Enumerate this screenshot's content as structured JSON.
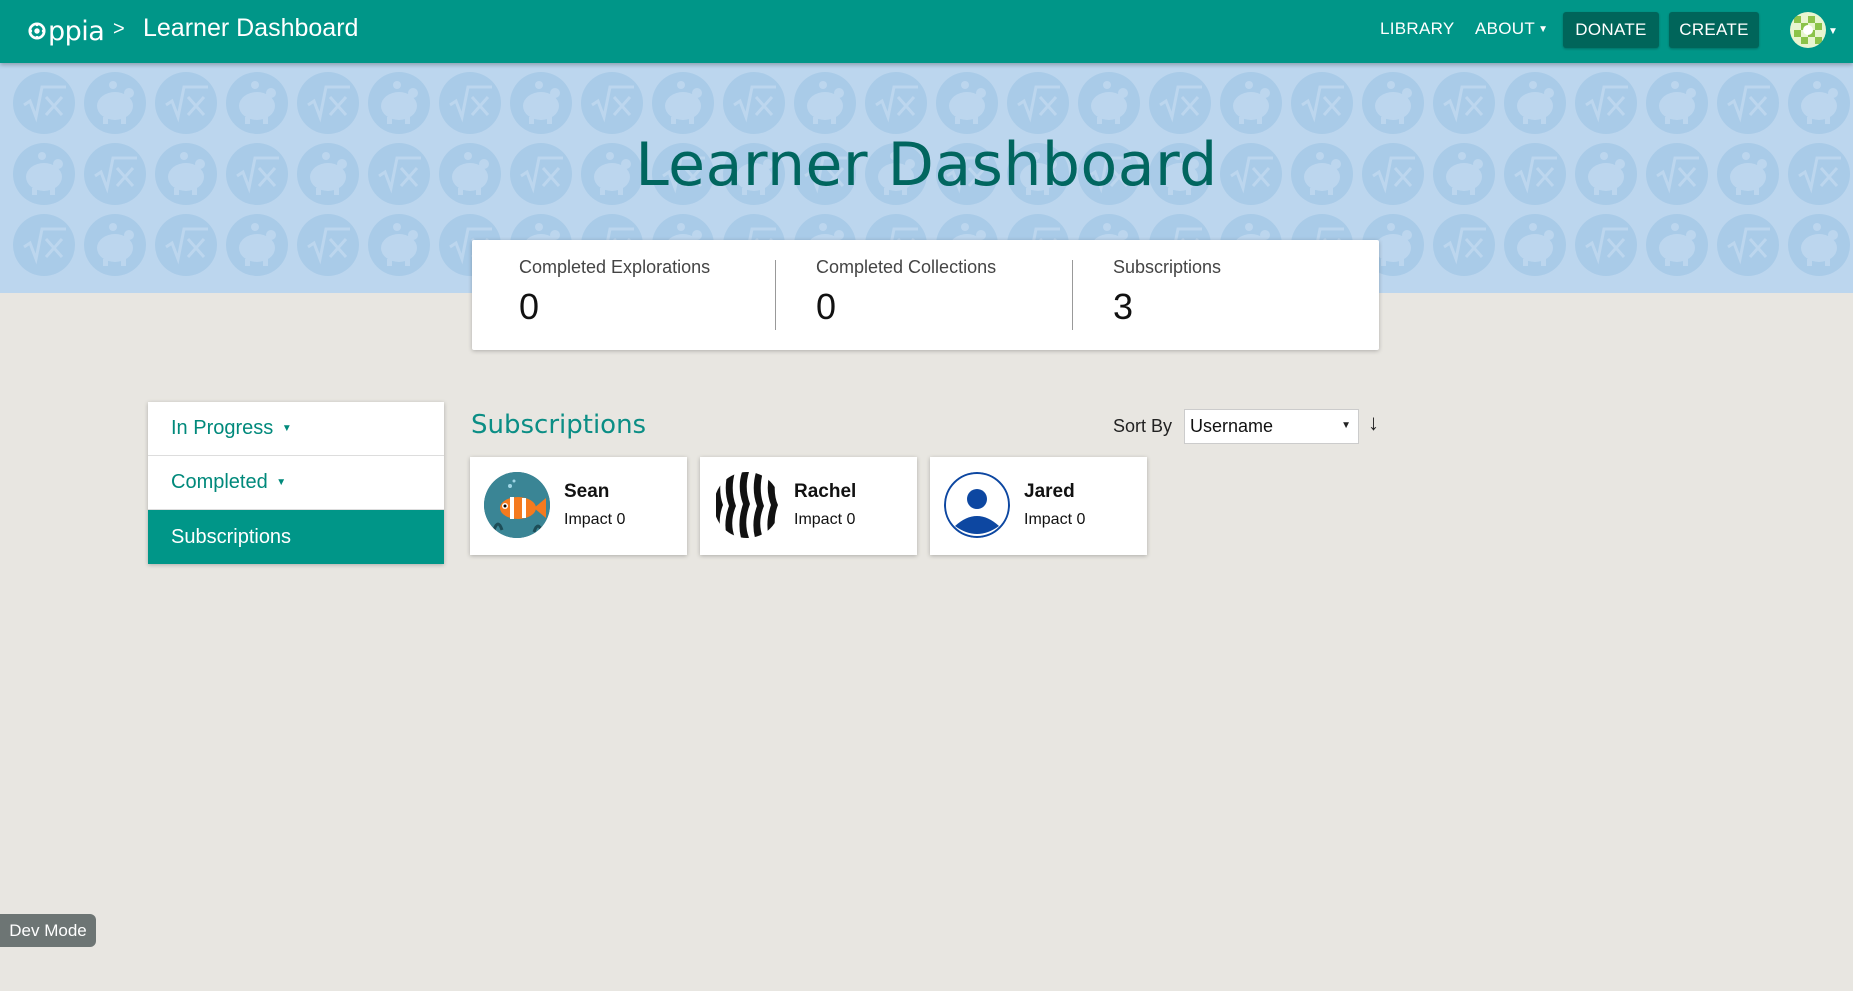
{
  "header": {
    "logo_text": "ppia",
    "breadcrumb_separator": ">",
    "page_name": "Learner Dashboard",
    "nav": {
      "library": "LIBRARY",
      "about": "ABOUT",
      "donate": "DONATE",
      "create": "CREATE"
    },
    "colors": {
      "bar": "#009688",
      "button": "#00655a"
    }
  },
  "banner": {
    "title": "Learner Dashboard",
    "pattern_icons": [
      "sqrt-x-icon",
      "piggy-bank-icon"
    ],
    "background": "#bcd6ee"
  },
  "stats": [
    {
      "label": "Completed Explorations",
      "value": "0"
    },
    {
      "label": "Completed Collections",
      "value": "0"
    },
    {
      "label": "Subscriptions",
      "value": "3"
    }
  ],
  "sidenav": [
    {
      "label": "In Progress",
      "has_dropdown": true,
      "active": false
    },
    {
      "label": "Completed",
      "has_dropdown": true,
      "active": false
    },
    {
      "label": "Subscriptions",
      "has_dropdown": false,
      "active": true
    }
  ],
  "section": {
    "title": "Subscriptions",
    "sort_label": "Sort By",
    "sort_value": "Username",
    "sort_direction_icon": "arrow-down-icon"
  },
  "subscriptions": [
    {
      "name": "Sean",
      "impact": "Impact 0",
      "avatar": "clownfish-avatar"
    },
    {
      "name": "Rachel",
      "impact": "Impact 0",
      "avatar": "zebra-stripes-avatar"
    },
    {
      "name": "Jared",
      "impact": "Impact 0",
      "avatar": "default-user-avatar"
    }
  ],
  "dev_mode": "Dev Mode"
}
